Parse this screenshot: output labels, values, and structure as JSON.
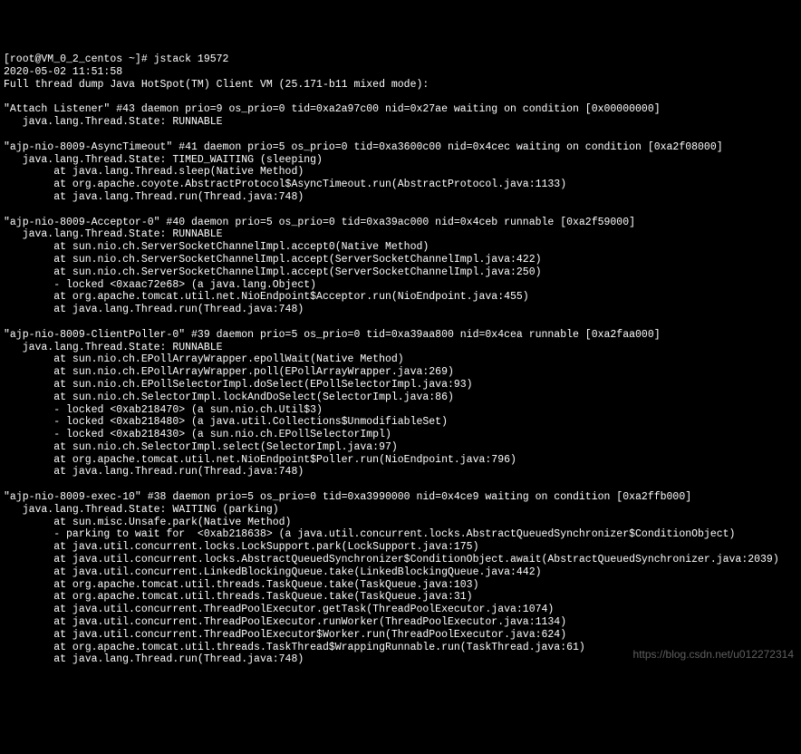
{
  "prompt_line": "[root@VM_0_2_centos ~]# jstack 19572",
  "timestamp": "2020-05-02 11:51:58",
  "header": "Full thread dump Java HotSpot(TM) Client VM (25.171-b11 mixed mode):",
  "threads": [
    {
      "title": "\"Attach Listener\" #43 daemon prio=9 os_prio=0 tid=0xa2a97c00 nid=0x27ae waiting on condition [0x00000000]",
      "state": "   java.lang.Thread.State: RUNNABLE",
      "stack": []
    },
    {
      "title": "\"ajp-nio-8009-AsyncTimeout\" #41 daemon prio=5 os_prio=0 tid=0xa3600c00 nid=0x4cec waiting on condition [0xa2f08000]",
      "state": "   java.lang.Thread.State: TIMED_WAITING (sleeping)",
      "stack": [
        "        at java.lang.Thread.sleep(Native Method)",
        "        at org.apache.coyote.AbstractProtocol$AsyncTimeout.run(AbstractProtocol.java:1133)",
        "        at java.lang.Thread.run(Thread.java:748)"
      ]
    },
    {
      "title": "\"ajp-nio-8009-Acceptor-0\" #40 daemon prio=5 os_prio=0 tid=0xa39ac000 nid=0x4ceb runnable [0xa2f59000]",
      "state": "   java.lang.Thread.State: RUNNABLE",
      "stack": [
        "        at sun.nio.ch.ServerSocketChannelImpl.accept0(Native Method)",
        "        at sun.nio.ch.ServerSocketChannelImpl.accept(ServerSocketChannelImpl.java:422)",
        "        at sun.nio.ch.ServerSocketChannelImpl.accept(ServerSocketChannelImpl.java:250)",
        "        - locked <0xaac72e68> (a java.lang.Object)",
        "        at org.apache.tomcat.util.net.NioEndpoint$Acceptor.run(NioEndpoint.java:455)",
        "        at java.lang.Thread.run(Thread.java:748)"
      ]
    },
    {
      "title": "\"ajp-nio-8009-ClientPoller-0\" #39 daemon prio=5 os_prio=0 tid=0xa39aa800 nid=0x4cea runnable [0xa2faa000]",
      "state": "   java.lang.Thread.State: RUNNABLE",
      "stack": [
        "        at sun.nio.ch.EPollArrayWrapper.epollWait(Native Method)",
        "        at sun.nio.ch.EPollArrayWrapper.poll(EPollArrayWrapper.java:269)",
        "        at sun.nio.ch.EPollSelectorImpl.doSelect(EPollSelectorImpl.java:93)",
        "        at sun.nio.ch.SelectorImpl.lockAndDoSelect(SelectorImpl.java:86)",
        "        - locked <0xab218470> (a sun.nio.ch.Util$3)",
        "        - locked <0xab218480> (a java.util.Collections$UnmodifiableSet)",
        "        - locked <0xab218430> (a sun.nio.ch.EPollSelectorImpl)",
        "        at sun.nio.ch.SelectorImpl.select(SelectorImpl.java:97)",
        "        at org.apache.tomcat.util.net.NioEndpoint$Poller.run(NioEndpoint.java:796)",
        "        at java.lang.Thread.run(Thread.java:748)"
      ]
    },
    {
      "title": "\"ajp-nio-8009-exec-10\" #38 daemon prio=5 os_prio=0 tid=0xa3990000 nid=0x4ce9 waiting on condition [0xa2ffb000]",
      "state": "   java.lang.Thread.State: WAITING (parking)",
      "stack": [
        "        at sun.misc.Unsafe.park(Native Method)",
        "        - parking to wait for  <0xab218638> (a java.util.concurrent.locks.AbstractQueuedSynchronizer$ConditionObject)",
        "        at java.util.concurrent.locks.LockSupport.park(LockSupport.java:175)",
        "        at java.util.concurrent.locks.AbstractQueuedSynchronizer$ConditionObject.await(AbstractQueuedSynchronizer.java:2039)",
        "        at java.util.concurrent.LinkedBlockingQueue.take(LinkedBlockingQueue.java:442)",
        "        at org.apache.tomcat.util.threads.TaskQueue.take(TaskQueue.java:103)",
        "        at org.apache.tomcat.util.threads.TaskQueue.take(TaskQueue.java:31)",
        "        at java.util.concurrent.ThreadPoolExecutor.getTask(ThreadPoolExecutor.java:1074)",
        "        at java.util.concurrent.ThreadPoolExecutor.runWorker(ThreadPoolExecutor.java:1134)",
        "        at java.util.concurrent.ThreadPoolExecutor$Worker.run(ThreadPoolExecutor.java:624)",
        "        at org.apache.tomcat.util.threads.TaskThread$WrappingRunnable.run(TaskThread.java:61)",
        "        at java.lang.Thread.run(Thread.java:748)"
      ]
    }
  ],
  "watermark": "https://blog.csdn.net/u012272314"
}
